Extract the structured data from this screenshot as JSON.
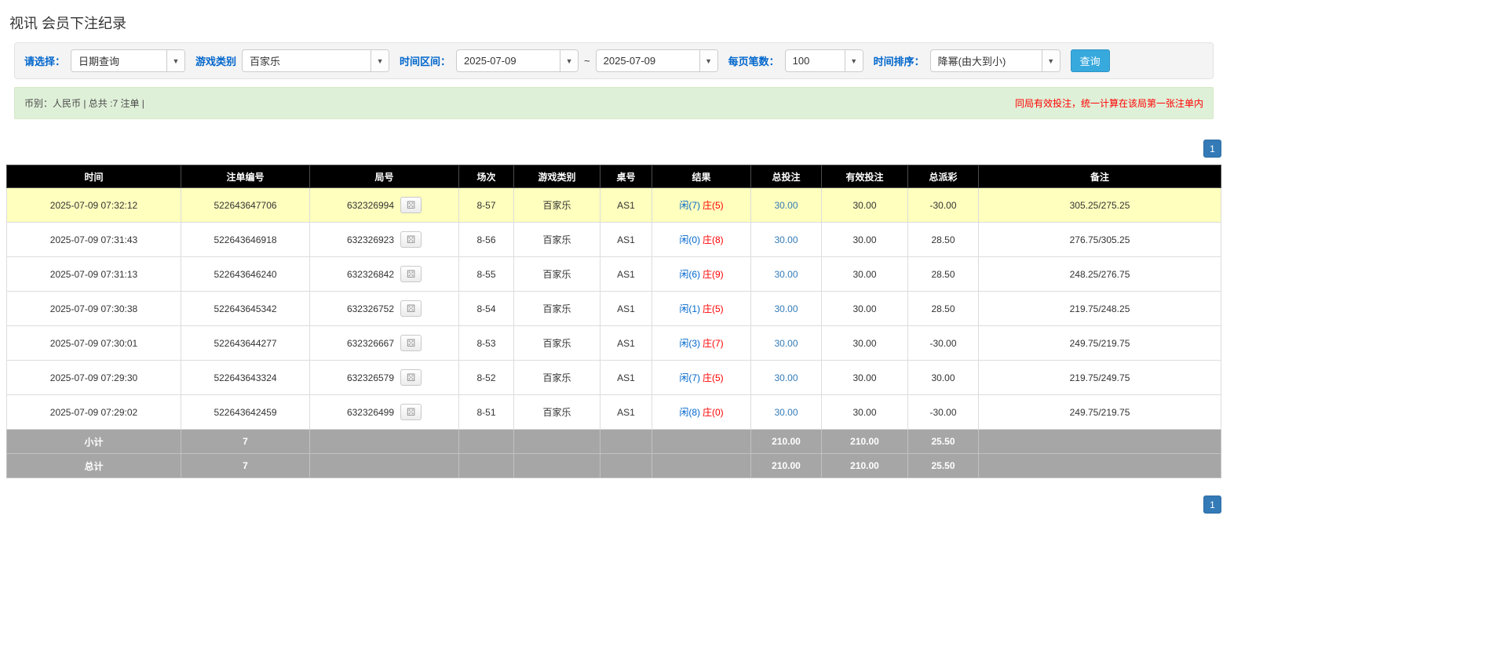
{
  "page": {
    "title": "视讯 会员下注纪录"
  },
  "filters": {
    "select_label": "请选择：",
    "select_value": "日期查询",
    "game_type_label": "游戏类别",
    "game_type_value": "百家乐",
    "time_range_label": "时间区间：",
    "date_from": "2025-07-09",
    "date_separator": "~",
    "date_to": "2025-07-09",
    "per_page_label": "每页笔数：",
    "per_page_value": "100",
    "sort_label": "时间排序：",
    "sort_value": "降幂(由大到小)",
    "search_button_label": "查询"
  },
  "summary_bar": {
    "left_text": "币别：人民币 | 总共 :7 注单 |",
    "right_notice": "同局有效投注，统一计算在该局第一张注单内"
  },
  "pagination": {
    "current_page": "1"
  },
  "icons": {
    "dropdown_caret": "▼",
    "round_preview": "⚄"
  },
  "colors": {
    "accent_blue": "#337ab7",
    "player_blue": "#0066cc",
    "banker_red": "#ff0000",
    "negative_red": "#ff0000",
    "highlight_yellow": "#ffffbe",
    "header_black": "#000000",
    "summary_gray": "#a6a6a6",
    "search_button_blue": "#38a9dd",
    "notice_bar_green": "#dff0d8"
  },
  "table": {
    "headers": [
      "时间",
      "注单编号",
      "局号",
      "场次",
      "游戏类别",
      "桌号",
      "结果",
      "总投注",
      "有效投注",
      "总派彩",
      "备注"
    ],
    "rows": [
      {
        "time": "2025-07-09 07:32:12",
        "bet_id": "522643647706",
        "round_id": "632326994",
        "session": "8-57",
        "game": "百家乐",
        "table_id": "AS1",
        "result_player": "闲(7)",
        "result_banker": "庄(5)",
        "total_bet": "30.00",
        "valid_bet": "30.00",
        "payout": "-30.00",
        "note": "305.25/275.25",
        "highlighted": true
      },
      {
        "time": "2025-07-09 07:31:43",
        "bet_id": "522643646918",
        "round_id": "632326923",
        "session": "8-56",
        "game": "百家乐",
        "table_id": "AS1",
        "result_player": "闲(0)",
        "result_banker": "庄(8)",
        "total_bet": "30.00",
        "valid_bet": "30.00",
        "payout": "28.50",
        "note": "276.75/305.25",
        "highlighted": false
      },
      {
        "time": "2025-07-09 07:31:13",
        "bet_id": "522643646240",
        "round_id": "632326842",
        "session": "8-55",
        "game": "百家乐",
        "table_id": "AS1",
        "result_player": "闲(6)",
        "result_banker": "庄(9)",
        "total_bet": "30.00",
        "valid_bet": "30.00",
        "payout": "28.50",
        "note": "248.25/276.75",
        "highlighted": false
      },
      {
        "time": "2025-07-09 07:30:38",
        "bet_id": "522643645342",
        "round_id": "632326752",
        "session": "8-54",
        "game": "百家乐",
        "table_id": "AS1",
        "result_player": "闲(1)",
        "result_banker": "庄(5)",
        "total_bet": "30.00",
        "valid_bet": "30.00",
        "payout": "28.50",
        "note": "219.75/248.25",
        "highlighted": false
      },
      {
        "time": "2025-07-09 07:30:01",
        "bet_id": "522643644277",
        "round_id": "632326667",
        "session": "8-53",
        "game": "百家乐",
        "table_id": "AS1",
        "result_player": "闲(3)",
        "result_banker": "庄(7)",
        "total_bet": "30.00",
        "valid_bet": "30.00",
        "payout": "-30.00",
        "note": "249.75/219.75",
        "highlighted": false
      },
      {
        "time": "2025-07-09 07:29:30",
        "bet_id": "522643643324",
        "round_id": "632326579",
        "session": "8-52",
        "game": "百家乐",
        "table_id": "AS1",
        "result_player": "闲(7)",
        "result_banker": "庄(5)",
        "total_bet": "30.00",
        "valid_bet": "30.00",
        "payout": "30.00",
        "note": "219.75/249.75",
        "highlighted": false
      },
      {
        "time": "2025-07-09 07:29:02",
        "bet_id": "522643642459",
        "round_id": "632326499",
        "session": "8-51",
        "game": "百家乐",
        "table_id": "AS1",
        "result_player": "闲(8)",
        "result_banker": "庄(0)",
        "total_bet": "30.00",
        "valid_bet": "30.00",
        "payout": "-30.00",
        "note": "249.75/219.75",
        "highlighted": false
      }
    ],
    "subtotal": {
      "label": "小计",
      "count": "7",
      "total_bet": "210.00",
      "valid_bet": "210.00",
      "payout": "25.50"
    },
    "total": {
      "label": "总计",
      "count": "7",
      "total_bet": "210.00",
      "valid_bet": "210.00",
      "payout": "25.50"
    }
  }
}
